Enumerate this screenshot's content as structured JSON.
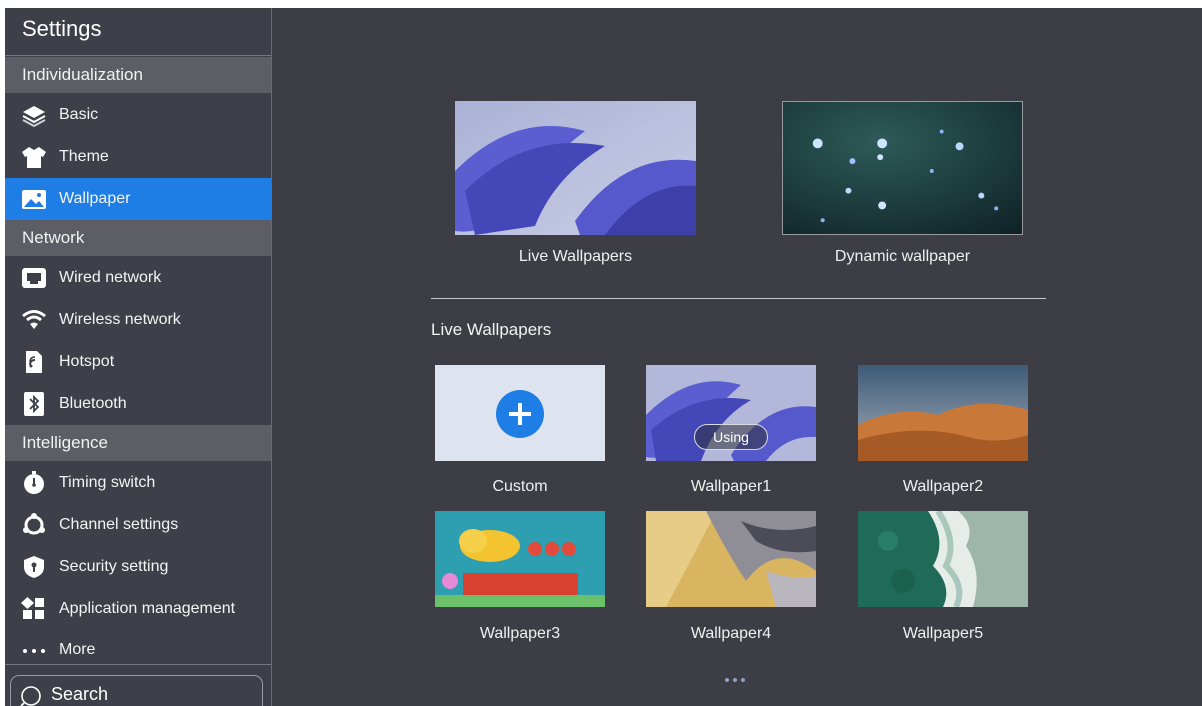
{
  "app": {
    "title": "Settings"
  },
  "sidebar": {
    "sections": [
      {
        "label": "Individualization"
      },
      {
        "label": "Network"
      },
      {
        "label": "Intelligence"
      }
    ],
    "items": [
      {
        "label": "Basic",
        "icon": "layers-icon"
      },
      {
        "label": "Theme",
        "icon": "shirt-icon"
      },
      {
        "label": "Wallpaper",
        "icon": "image-icon",
        "active": true
      },
      {
        "label": "Wired network",
        "icon": "ethernet-icon"
      },
      {
        "label": "Wireless network",
        "icon": "wifi-icon"
      },
      {
        "label": "Hotspot",
        "icon": "hotspot-icon"
      },
      {
        "label": "Bluetooth",
        "icon": "bluetooth-icon"
      },
      {
        "label": "Timing switch",
        "icon": "timer-icon"
      },
      {
        "label": "Channel settings",
        "icon": "channel-icon"
      },
      {
        "label": "Security setting",
        "icon": "shield-icon"
      },
      {
        "label": "Application management",
        "icon": "apps-grid-icon"
      },
      {
        "label": "More",
        "icon": "more-dots-icon"
      }
    ],
    "search": {
      "label": "Search",
      "icon": "search-icon"
    }
  },
  "main": {
    "categories": [
      {
        "label": "Live Wallpapers"
      },
      {
        "label": "Dynamic wallpaper"
      }
    ],
    "section_title": "Live Wallpapers",
    "wallpapers": [
      {
        "label": "Custom",
        "icon": "plus-icon"
      },
      {
        "label": "Wallpaper1",
        "badge": "Using"
      },
      {
        "label": "Wallpaper2"
      },
      {
        "label": "Wallpaper3"
      },
      {
        "label": "Wallpaper4"
      },
      {
        "label": "Wallpaper5"
      }
    ],
    "pager": {
      "pages": 3
    }
  },
  "colors": {
    "accent": "#1f7de6",
    "background": "#3c3d45",
    "section": "#5c5d65"
  }
}
